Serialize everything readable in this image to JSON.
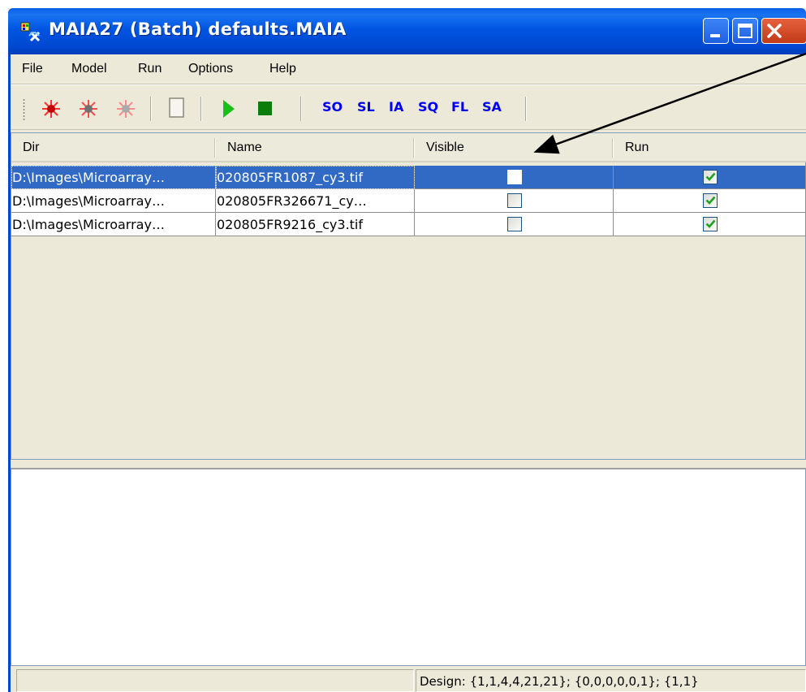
{
  "window": {
    "title": "MAIA27 (Batch) defaults.MAIA"
  },
  "menu": {
    "items": [
      "File",
      "Model",
      "Run",
      "Options",
      "Help"
    ]
  },
  "toolbar": {
    "text_buttons": [
      "SO",
      "SL",
      "IA",
      "SQ",
      "FL",
      "SA"
    ],
    "icons": [
      "bug-red-icon",
      "bug-gray-icon",
      "bug-faded-icon",
      "blank-page-icon",
      "play-icon",
      "stop-icon"
    ]
  },
  "table": {
    "columns": [
      "Dir",
      "Name",
      "Visible",
      "Run"
    ],
    "rows": [
      {
        "dir": "D:\\Images\\Microarray…",
        "name": "020805FR1087_cy3.tif",
        "visible": false,
        "run": true,
        "selected": true
      },
      {
        "dir": "D:\\Images\\Microarray…",
        "name": "020805FR326671_cy…",
        "visible": false,
        "run": true,
        "selected": false
      },
      {
        "dir": "D:\\Images\\Microarray…",
        "name": "020805FR9216_cy3.tif",
        "visible": false,
        "run": true,
        "selected": false
      }
    ]
  },
  "status": {
    "left": "",
    "right": "Design: {1,1,4,4,21,21}; {0,0,0,0,0,1}; {1,1}"
  },
  "colors": {
    "title_bar": "#0055e2",
    "selection": "#316ac5",
    "check": "#21a121",
    "toolbar_text": "#0000ee"
  }
}
